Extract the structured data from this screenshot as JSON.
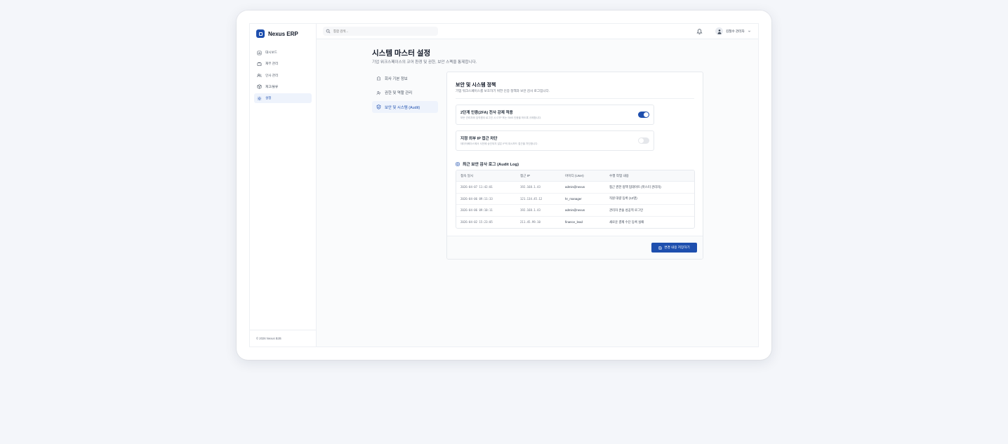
{
  "brand": {
    "name": "Nexus ERP",
    "accent": "#1e4fae"
  },
  "sidebar": {
    "items": [
      {
        "label": "대시보드",
        "icon": "dashboard-icon",
        "active": false
      },
      {
        "label": "재무 관리",
        "icon": "wallet-icon",
        "active": false
      },
      {
        "label": "인사 관리",
        "icon": "users-icon",
        "active": false
      },
      {
        "label": "재고/물류",
        "icon": "box-icon",
        "active": false
      },
      {
        "label": "설정",
        "icon": "gear-icon",
        "active": true
      }
    ],
    "footer": "© 2026 Nexus B2B"
  },
  "topbar": {
    "search_placeholder": "통합 검색...",
    "user_name": "김철수 관리자"
  },
  "page": {
    "title": "시스템 마스터 설정",
    "subtitle": "기업 워크스페이스의 코어 환경 및 권한, 보안 스펙을 통제합니다."
  },
  "subnav": {
    "items": [
      {
        "label": "회사 기본 정보",
        "icon": "building-icon",
        "active": false
      },
      {
        "label": "권한 및 역할 관리",
        "icon": "user-role-icon",
        "active": false
      },
      {
        "label": "보안 및 시스템 (Audit)",
        "icon": "shield-check-icon",
        "active": true
      }
    ]
  },
  "security": {
    "title": "보안 및 시스템 정책",
    "subtitle": "기업 워크스페이스를 보호하기 위한 인증 정책과 보안 감사 로그입니다.",
    "policies": [
      {
        "title": "2단계 인증(2FA) 전사 강제 적용",
        "description": "모든 관리자와 임직원이 로그인 시 OTP 또는 SMS 인증을 하도록 규제합니다.",
        "enabled": true
      },
      {
        "title": "지정 외부 IP 접근 차단",
        "description": "데이터베이스에서 사전에 승인되지 않은 IP의 대시보드 접근을 차단합니다.",
        "enabled": false
      }
    ],
    "log_title": "최근 보안 감사 로그 (Audit Log)",
    "log_columns": [
      "접속 일시",
      "접근 IP",
      "아이디 (User)",
      "수행 작업 내용"
    ],
    "log_rows": [
      {
        "time": "2026-04-07 11:42:01",
        "ip": "192.168.1.43",
        "user": "admin@nexus",
        "action": "접근 권한 정책 업데이트 (마스터 관리자)"
      },
      {
        "time": "2026-04-06 09:11:33",
        "ip": "121.134.45.12",
        "user": "hr_manager",
        "action": "직원 대량 등록 (12명)"
      },
      {
        "time": "2026-04-06 09:10:11",
        "ip": "192.168.1.43",
        "user": "admin@nexus",
        "action": "관리자 콘솔 성공적 로그인"
      },
      {
        "time": "2026-04-02 15:23:05",
        "ip": "211.45.99.10",
        "user": "finance_lead",
        "action": "새로운 결제 수단 등록 실패"
      }
    ],
    "save_label": "변경 내용 저장하기"
  }
}
